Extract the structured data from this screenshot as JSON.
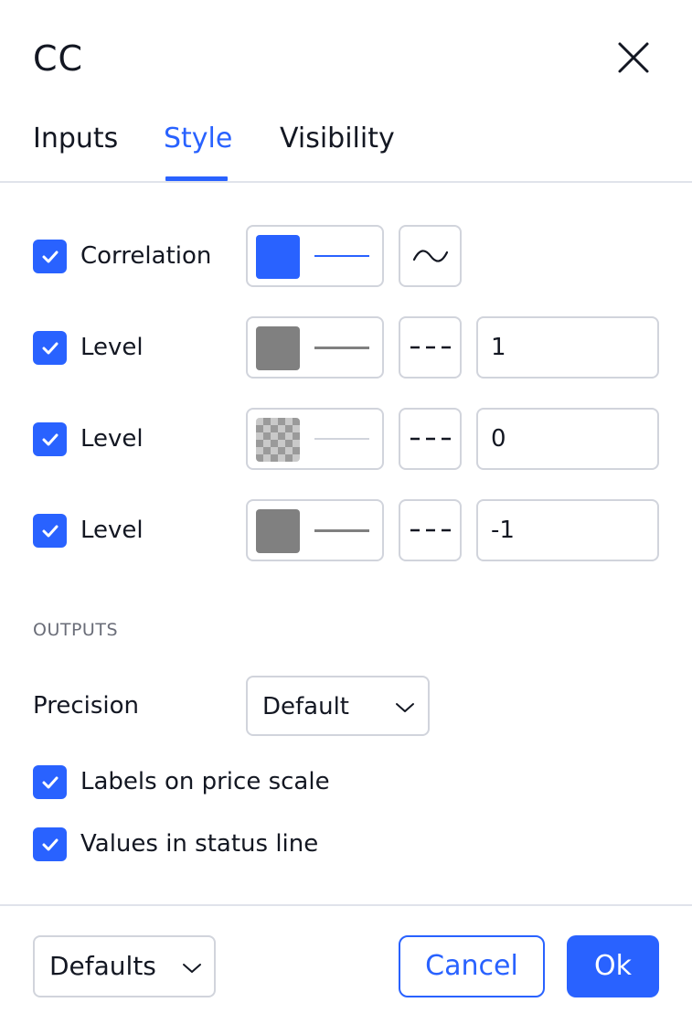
{
  "dialog": {
    "title": "CC",
    "close_icon": "close-icon"
  },
  "tabs": [
    {
      "label": "Inputs",
      "active": false
    },
    {
      "label": "Style",
      "active": true
    },
    {
      "label": "Visibility",
      "active": false
    }
  ],
  "plots": [
    {
      "checked": true,
      "label": "Correlation",
      "color": "#2962ff",
      "line_style": "solid",
      "plot_type_icon": "line-wave-icon"
    },
    {
      "checked": true,
      "label": "Level",
      "color": "#808080",
      "line_style": "dashed",
      "value": "1"
    },
    {
      "checked": true,
      "label": "Level",
      "color": "transparent",
      "line_style": "dashed",
      "value": "0"
    },
    {
      "checked": true,
      "label": "Level",
      "color": "#808080",
      "line_style": "dashed",
      "value": "-1"
    }
  ],
  "outputs": {
    "section_title": "OUTPUTS",
    "precision_label": "Precision",
    "precision_value": "Default",
    "labels_on_price_scale": {
      "checked": true,
      "label": "Labels on price scale"
    },
    "values_in_status_line": {
      "checked": true,
      "label": "Values in status line"
    }
  },
  "footer": {
    "defaults_label": "Defaults",
    "cancel_label": "Cancel",
    "ok_label": "Ok"
  },
  "colors": {
    "accent": "#2962ff",
    "border": "#d1d4dc",
    "muted_text": "#6a6d78"
  }
}
